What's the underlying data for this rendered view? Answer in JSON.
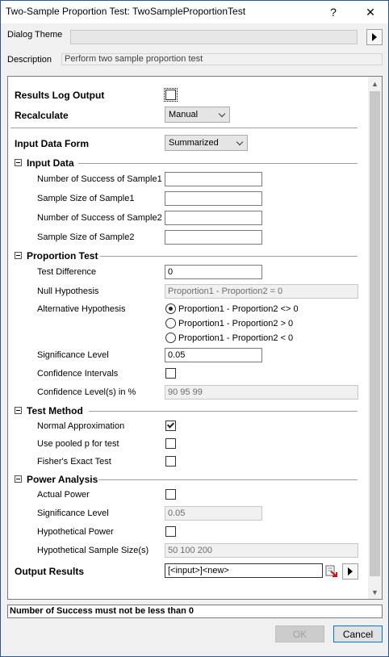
{
  "window": {
    "title": "Two-Sample Proportion Test: TwoSampleProportionTest",
    "help_label": "?",
    "close_label": "✕"
  },
  "theme": {
    "label": "Dialog Theme"
  },
  "description": {
    "label": "Description",
    "value": "Perform two sample proportion test"
  },
  "results_log": {
    "label": "Results Log Output",
    "checked": false
  },
  "recalculate": {
    "label": "Recalculate",
    "value": "Manual"
  },
  "input_form": {
    "label": "Input Data Form",
    "value": "Summarized"
  },
  "input_data": {
    "header": "Input Data",
    "fields": [
      {
        "label": "Number of Success of Sample1",
        "value": ""
      },
      {
        "label": "Sample Size of Sample1",
        "value": ""
      },
      {
        "label": "Number of Success of Sample2",
        "value": ""
      },
      {
        "label": "Sample Size of Sample2",
        "value": ""
      }
    ]
  },
  "proportion_test": {
    "header": "Proportion Test",
    "test_difference": {
      "label": "Test Difference",
      "value": "0"
    },
    "null_hypothesis": {
      "label": "Null Hypothesis",
      "value": "Proportion1 - Proportion2 = 0"
    },
    "alternative": {
      "label": "Alternative Hypothesis",
      "options": [
        "Proportion1 - Proportion2 <> 0",
        "Proportion1 - Proportion2 > 0",
        "Proportion1 - Proportion2 < 0"
      ],
      "selected_index": 0
    },
    "significance": {
      "label": "Significance Level",
      "value": "0.05"
    },
    "confidence_intervals": {
      "label": "Confidence Intervals",
      "checked": false
    },
    "confidence_levels": {
      "label": "Confidence Level(s) in %",
      "value": "90 95 99"
    }
  },
  "test_method": {
    "header": "Test Method",
    "normal_approx": {
      "label": "Normal Approximation",
      "checked": true
    },
    "pooled_p": {
      "label": "Use pooled p for test",
      "checked": false
    },
    "fisher": {
      "label": "Fisher's Exact Test",
      "checked": false
    }
  },
  "power_analysis": {
    "header": "Power Analysis",
    "actual_power": {
      "label": "Actual Power",
      "checked": false
    },
    "significance": {
      "label": "Significance Level",
      "value": "0.05"
    },
    "hypothetical_power": {
      "label": "Hypothetical Power",
      "checked": false
    },
    "sample_sizes": {
      "label": "Hypothetical Sample Size(s)",
      "value": "50 100 200"
    }
  },
  "output_results": {
    "label": "Output Results",
    "value": "[<input>]<new>"
  },
  "status_message": "Number of Success must not be less than 0",
  "buttons": {
    "ok": "OK",
    "cancel": "Cancel"
  }
}
